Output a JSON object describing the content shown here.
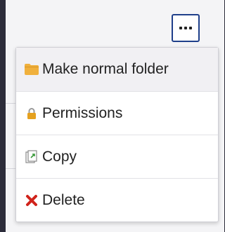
{
  "more_button": {
    "icon": "ellipsis-icon"
  },
  "menu": {
    "items": [
      {
        "label": "Make normal folder",
        "icon": "folder-icon",
        "color": "#f0b03c"
      },
      {
        "label": "Permissions",
        "icon": "lock-icon",
        "color": "#e5a11f"
      },
      {
        "label": "Copy",
        "icon": "copy-icon",
        "color": "#8a8a8a"
      },
      {
        "label": "Delete",
        "icon": "delete-icon",
        "color": "#d0231b"
      }
    ]
  }
}
